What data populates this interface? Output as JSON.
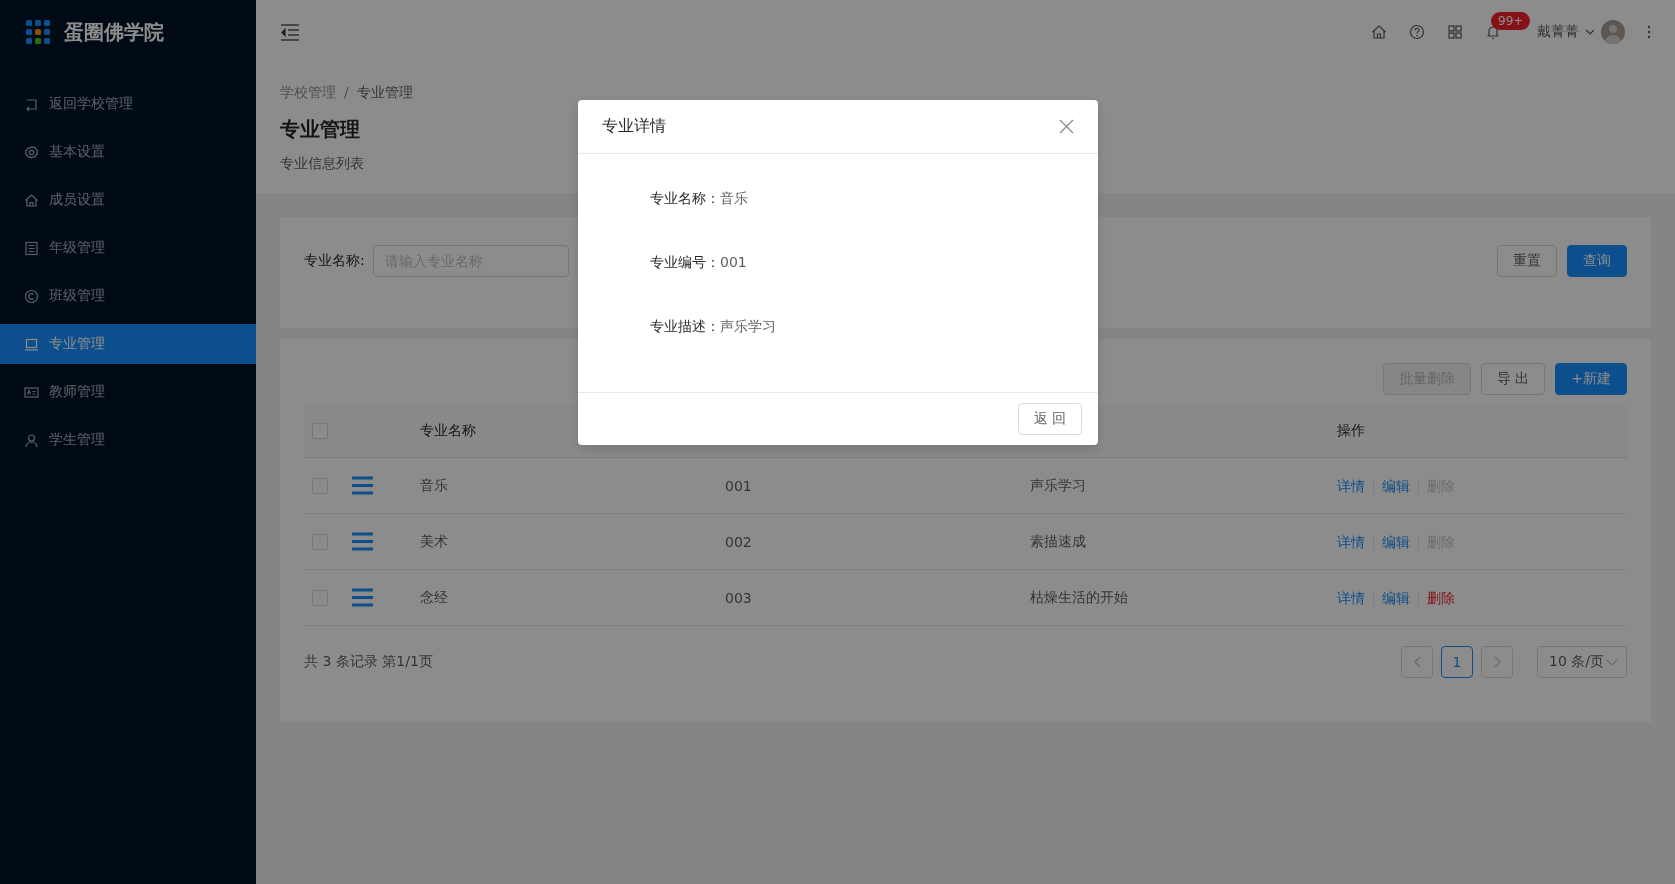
{
  "sidebar": {
    "logo_text": "蛋圈佛学院",
    "items": [
      {
        "label": "返回学校管理",
        "selected": false
      },
      {
        "label": "基本设置",
        "selected": false
      },
      {
        "label": "成员设置",
        "selected": false
      },
      {
        "label": "年级管理",
        "selected": false
      },
      {
        "label": "班级管理",
        "selected": false
      },
      {
        "label": "专业管理",
        "selected": true
      },
      {
        "label": "教师管理",
        "selected": false
      },
      {
        "label": "学生管理",
        "selected": false
      }
    ]
  },
  "header": {
    "notification_badge": "99+",
    "user_name": "戴菁菁"
  },
  "page_header": {
    "breadcrumb": [
      "学校管理",
      "专业管理"
    ],
    "breadcrumb_separator": "/",
    "title": "专业管理",
    "subtitle": "专业信息列表"
  },
  "search_form": {
    "label": "专业名称:",
    "placeholder": "请输入专业名称",
    "buttons": [
      {
        "label": "重置",
        "kind": "default"
      },
      {
        "label": "查询",
        "kind": "primary"
      }
    ]
  },
  "toolbar": [
    {
      "label": "批量删除",
      "kind": "default",
      "disabled": true
    },
    {
      "label": "导 出",
      "kind": "default",
      "disabled": false
    },
    {
      "label": "+新建",
      "kind": "primary",
      "disabled": false
    }
  ],
  "table": {
    "select_all_checked": false,
    "name_header": "专业名称",
    "actions_header": "操作",
    "rows": [
      {
        "checked": false,
        "name": "音乐",
        "code": "001",
        "description": "声乐学习",
        "actions": [
          {
            "label": "详情",
            "kind": "link",
            "disabled": false
          },
          {
            "label": "编辑",
            "kind": "link",
            "disabled": false
          },
          {
            "label": "删除",
            "kind": "danger",
            "disabled": true
          }
        ]
      },
      {
        "checked": false,
        "name": "美术",
        "code": "002",
        "description": "素描速成",
        "actions": [
          {
            "label": "详情",
            "kind": "link",
            "disabled": false
          },
          {
            "label": "编辑",
            "kind": "link",
            "disabled": false
          },
          {
            "label": "删除",
            "kind": "danger",
            "disabled": true
          }
        ]
      },
      {
        "checked": false,
        "name": "念经",
        "code": "003",
        "description": "枯燥生活的开始",
        "actions": [
          {
            "label": "详情",
            "kind": "link",
            "disabled": false
          },
          {
            "label": "编辑",
            "kind": "link",
            "disabled": false
          },
          {
            "label": "删除",
            "kind": "danger",
            "disabled": false
          }
        ]
      }
    ]
  },
  "footer": {
    "summary": "共 3 条记录 第1/1页",
    "pages": [
      {
        "label": "1",
        "selected": true
      }
    ],
    "page_size": "10 条/页"
  },
  "modal": {
    "title": "专业详情",
    "fields": [
      {
        "label": "专业名称：",
        "value": "音乐"
      },
      {
        "label": "专业编号：",
        "value": "001"
      },
      {
        "label": "专业描述：",
        "value": "声乐学习"
      }
    ],
    "button": "返 回"
  }
}
